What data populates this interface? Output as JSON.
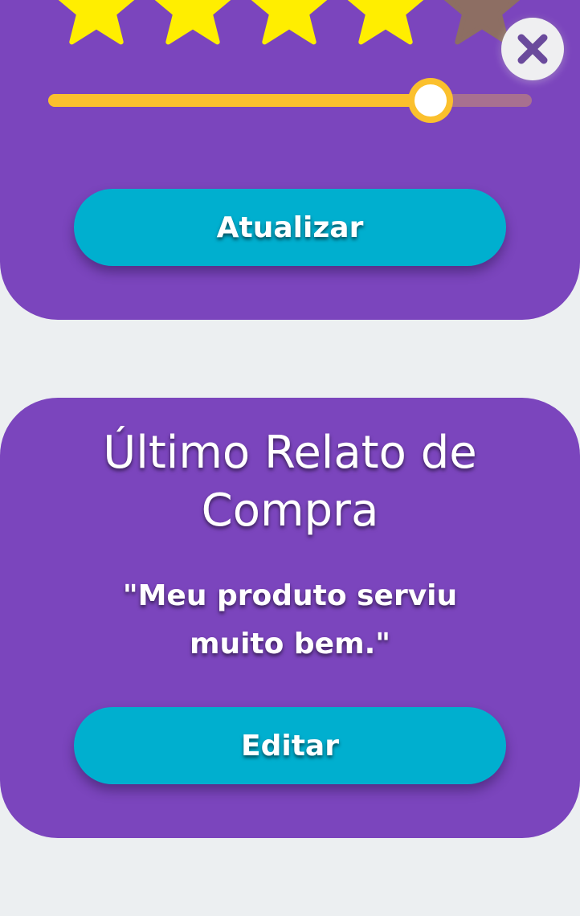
{
  "rating": {
    "value": 4,
    "max": 5,
    "star_filled_color": "#ffee00",
    "star_empty_color": "#8d6e63",
    "slider_fraction": 0.79,
    "slider_fill_color": "#fbc02d"
  },
  "close_icon": "close-icon",
  "update_button_label": "Atualizar",
  "report": {
    "title": "Último Relato de Compra",
    "quote": "\"Meu produto serviu muito bem.\"",
    "edit_button_label": "Editar"
  },
  "colors": {
    "card": "#7b45bd",
    "background": "#eceff1",
    "button": "#00afcf"
  }
}
